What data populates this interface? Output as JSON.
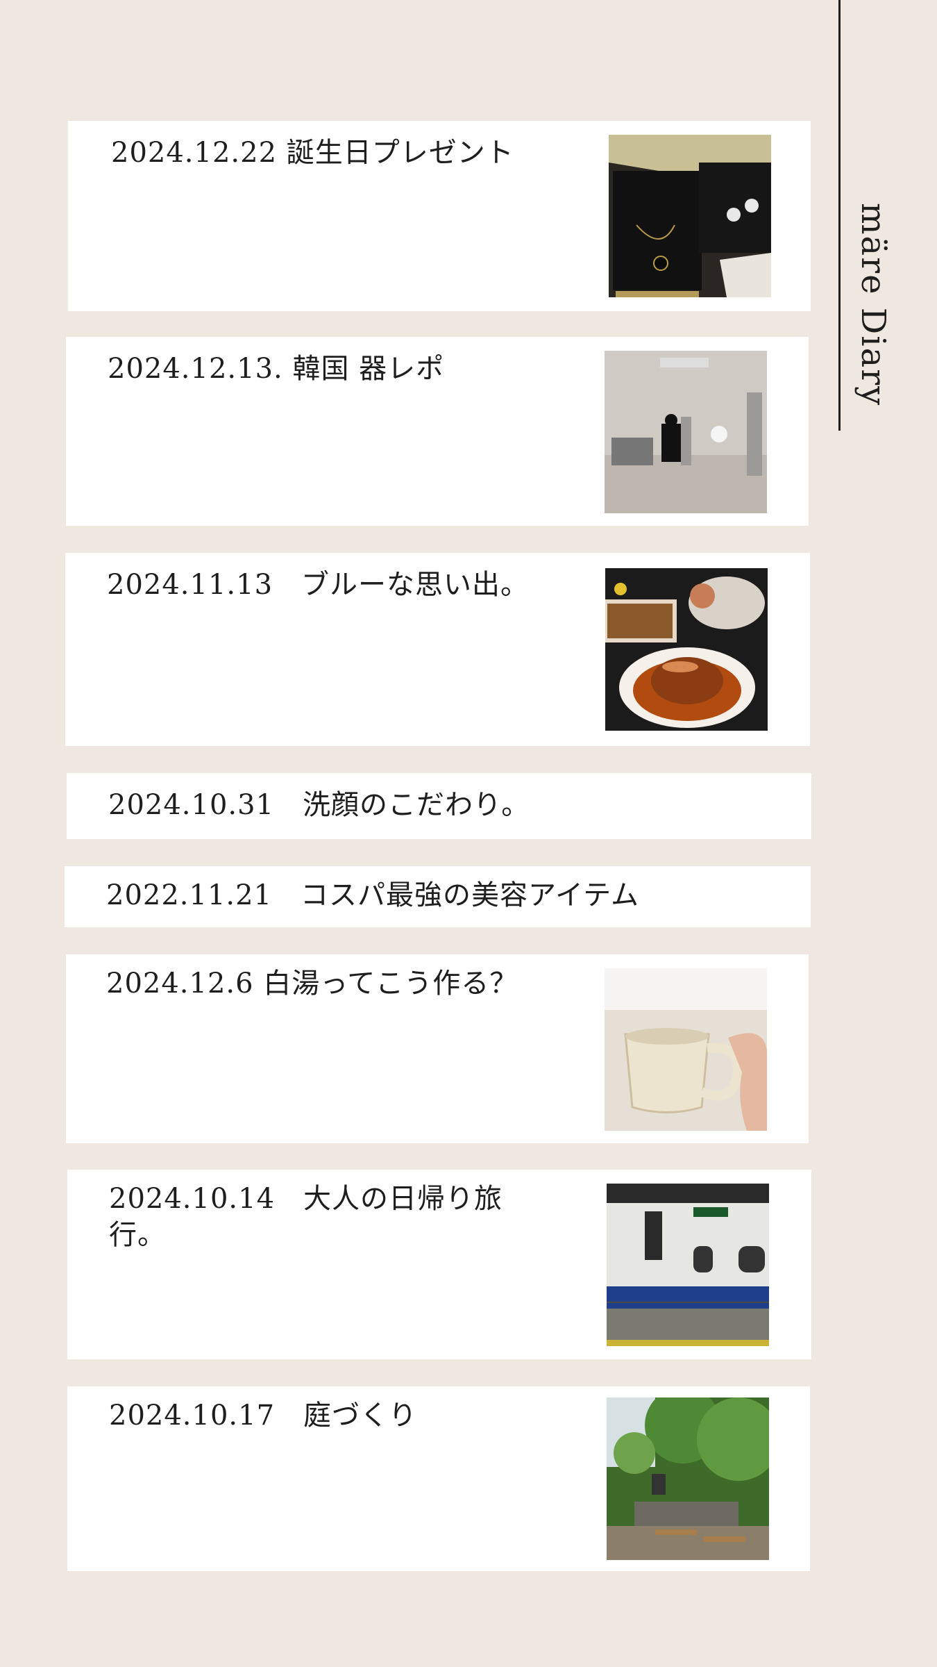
{
  "brand": {
    "title": "märe Diary"
  },
  "entries": [
    {
      "title": "2024.12.22 誕生日プレゼント",
      "image": "jewelry-gift-photo"
    },
    {
      "title": "2024.12.13. 韓国 器レポ",
      "image": "korea-tableware-shop-photo"
    },
    {
      "title": "2024.11.13　ブルーな思い出。",
      "image": "pudding-dessert-photo"
    },
    {
      "title": "2024.10.31　洗顔のこだわり。"
    },
    {
      "title": "2022.11.21　コスパ最強の美容アイテム"
    },
    {
      "title": "2024.12.6 白湯ってこう作る？",
      "image": "ceramic-mug-photo"
    },
    {
      "title": "2024.10.14　大人の日帰り旅\n行。",
      "image": "bullet-train-photo"
    },
    {
      "title": "2024.10.17　庭づくり",
      "image": "garden-cafe-photo"
    }
  ]
}
